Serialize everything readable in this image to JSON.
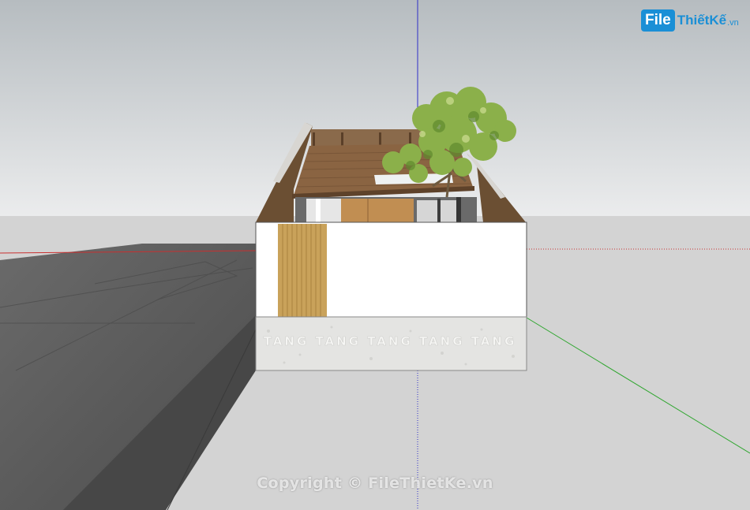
{
  "logo": {
    "badge": "File",
    "name": "ThiếtKế",
    "domain": ".vn"
  },
  "watermark": {
    "text": "Copyright © FileThietKe.vn"
  },
  "wall_stamp": {
    "text": "TANG TANG TANG TANG TANG"
  },
  "colors": {
    "sky_top": "#b6bcc0",
    "sky_bottom": "#ebeced",
    "ground": "#d3d3d3",
    "road": "#5c5c5c",
    "wall_white": "#ffffff",
    "wall_base": "#e4e4e2",
    "wood_roof": "#8a6442",
    "bamboo": "#c9a25a",
    "axis_red": "#c83030",
    "axis_green": "#2fa62f",
    "axis_blue": "#2e2ec8",
    "tree_green": "#8bb04a"
  }
}
